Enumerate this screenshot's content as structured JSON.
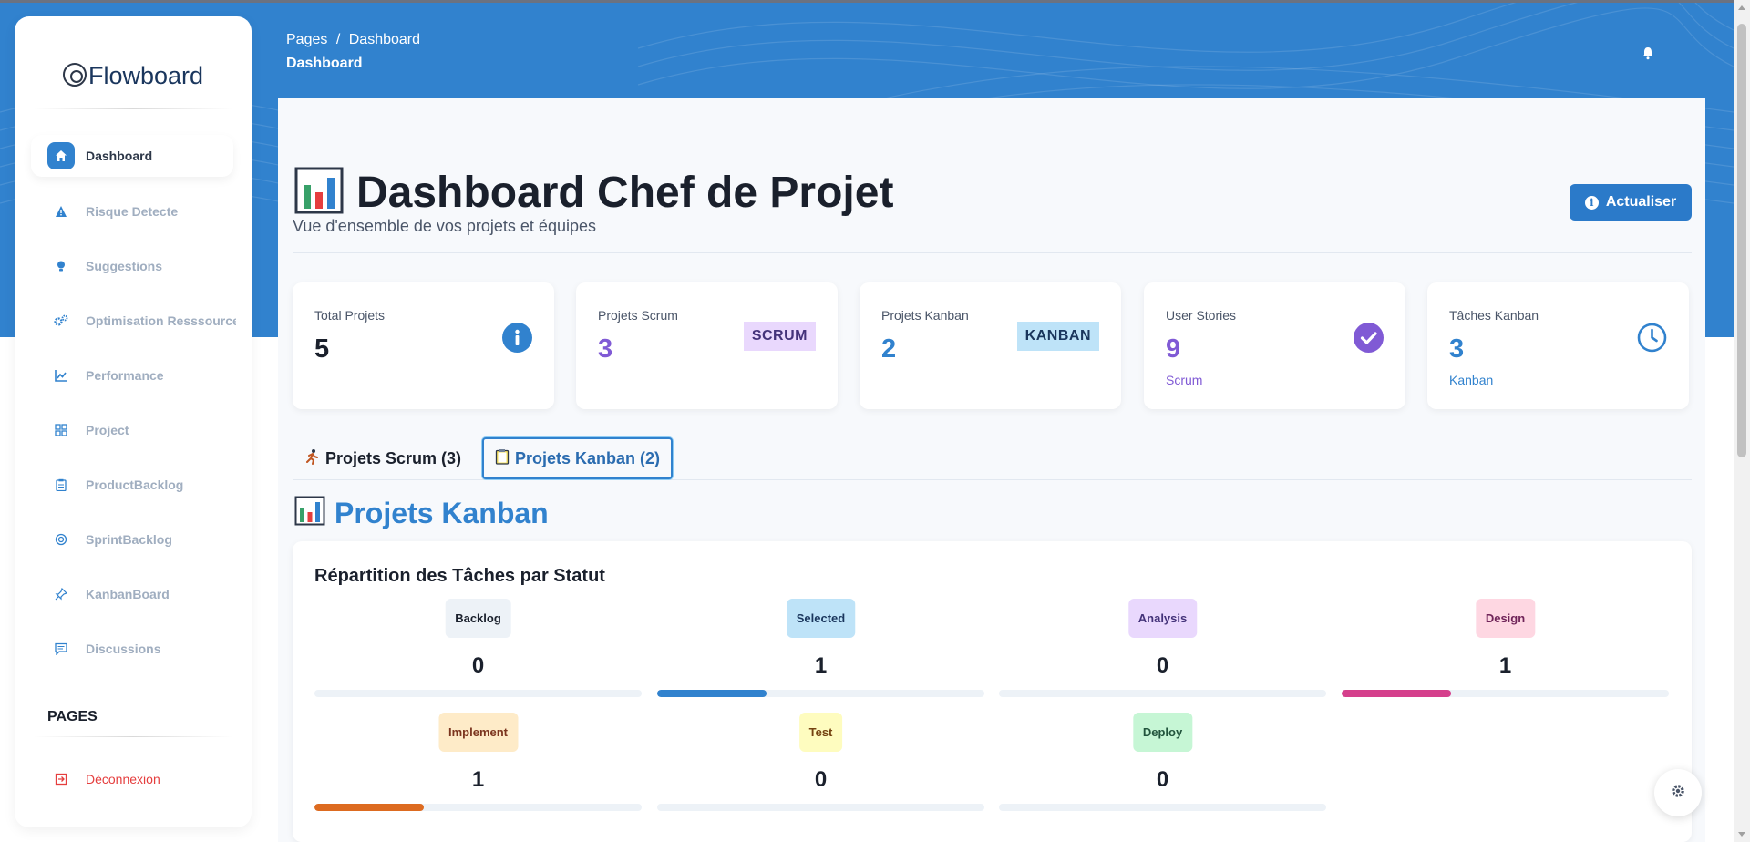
{
  "app": {
    "name": "Flowboard"
  },
  "sidebar": {
    "items": [
      {
        "label": "Dashboard",
        "icon": "home-icon"
      },
      {
        "label": "Risque Detecte",
        "icon": "warning-icon"
      },
      {
        "label": "Suggestions",
        "icon": "lightbulb-icon"
      },
      {
        "label": "Optimisation Resssources",
        "icon": "cogs-icon"
      },
      {
        "label": "Performance",
        "icon": "chart-line-icon"
      },
      {
        "label": "Project",
        "icon": "grid-icon"
      },
      {
        "label": "ProductBacklog",
        "icon": "clipboard-icon"
      },
      {
        "label": "SprintBacklog",
        "icon": "target-icon"
      },
      {
        "label": "KanbanBoard",
        "icon": "pin-icon"
      },
      {
        "label": "Discussions",
        "icon": "message-icon"
      }
    ],
    "pages_label": "PAGES",
    "logout_label": "Déconnexion"
  },
  "header": {
    "breadcrumb_root": "Pages",
    "breadcrumb_sep": "/",
    "breadcrumb_current": "Dashboard",
    "title": "Dashboard"
  },
  "page": {
    "title": "Dashboard Chef de Projet",
    "subtitle": "Vue d'ensemble de vos projets et équipes",
    "refresh_label": "Actualiser"
  },
  "stats": [
    {
      "label": "Total Projets",
      "value": "5",
      "color": "#1a202c"
    },
    {
      "label": "Projets Scrum",
      "value": "3",
      "badge": "SCRUM",
      "color": "#805ad5"
    },
    {
      "label": "Projets Kanban",
      "value": "2",
      "badge": "KANBAN",
      "color": "#3182ce"
    },
    {
      "label": "User Stories",
      "value": "9",
      "sub": "Scrum",
      "color": "#805ad5"
    },
    {
      "label": "Tâches Kanban",
      "value": "3",
      "sub": "Kanban",
      "color": "#3182ce"
    }
  ],
  "tabs": [
    {
      "label": "Projets Scrum (3)",
      "icon": "runner-icon"
    },
    {
      "label": "Projets Kanban (2)",
      "icon": "clipboard-icon"
    }
  ],
  "section": {
    "title": "Projets Kanban"
  },
  "status_card": {
    "title": "Répartition des Tâches par Statut",
    "statuses": [
      {
        "name": "Backlog",
        "count": "0",
        "fraction": 0,
        "bg": "#edf2f7",
        "fg": "#1a202c",
        "bar": "#3182ce"
      },
      {
        "name": "Selected",
        "count": "1",
        "fraction": 0.333,
        "bg": "#bee3f8",
        "fg": "#1a365d",
        "bar": "#3182ce"
      },
      {
        "name": "Analysis",
        "count": "0",
        "fraction": 0,
        "bg": "#e9d8fd",
        "fg": "#44337a",
        "bar": "#805ad5"
      },
      {
        "name": "Design",
        "count": "1",
        "fraction": 0.333,
        "bg": "#fed7e2",
        "fg": "#702459",
        "bar": "#d53f8c"
      },
      {
        "name": "Implement",
        "count": "1",
        "fraction": 0.333,
        "bg": "#feebc8",
        "fg": "#7b341e",
        "bar": "#dd6b20"
      },
      {
        "name": "Test",
        "count": "0",
        "fraction": 0,
        "bg": "#fefcbf",
        "fg": "#744210",
        "bar": "#d69e2e"
      },
      {
        "name": "Deploy",
        "count": "0",
        "fraction": 0,
        "bg": "#c6f6d5",
        "fg": "#22543d",
        "bar": "#38a169"
      }
    ]
  }
}
